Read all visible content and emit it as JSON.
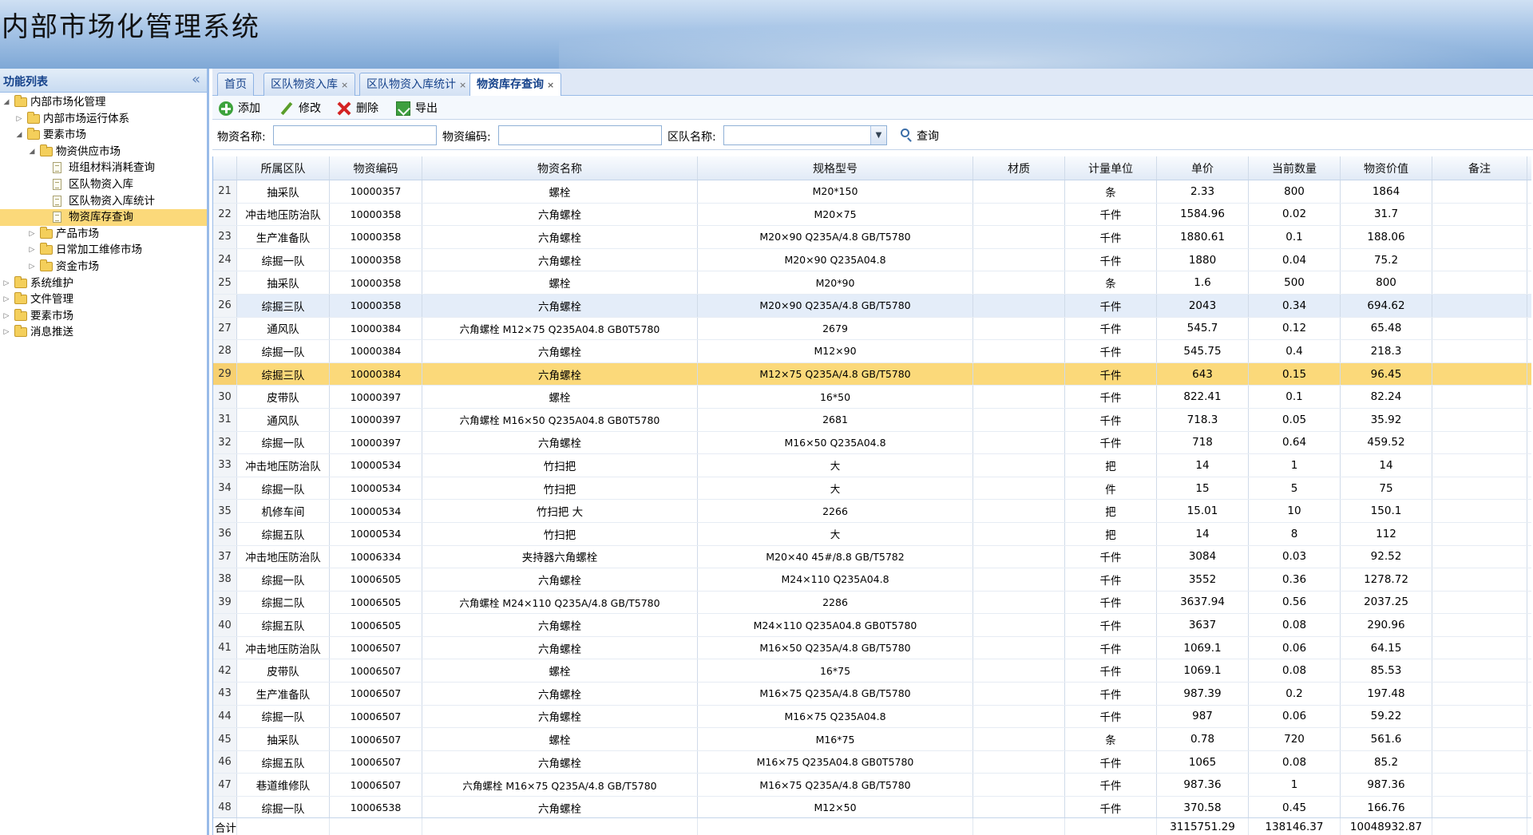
{
  "app": {
    "title": "内部市场化管理系统"
  },
  "sidebar": {
    "header": "功能列表",
    "collapse_glyph": "«",
    "items": [
      {
        "label": "内部市场化管理",
        "level": 0,
        "type": "folder",
        "state": "open"
      },
      {
        "label": "内部市场运行体系",
        "level": 1,
        "type": "folder",
        "state": "closed"
      },
      {
        "label": "要素市场",
        "level": 1,
        "type": "folder",
        "state": "open"
      },
      {
        "label": "物资供应市场",
        "level": 2,
        "type": "folder",
        "state": "open"
      },
      {
        "label": "班组材料消耗查询",
        "level": 3,
        "type": "doc"
      },
      {
        "label": "区队物资入库",
        "level": 3,
        "type": "doc"
      },
      {
        "label": "区队物资入库统计",
        "level": 3,
        "type": "doc"
      },
      {
        "label": "物资库存查询",
        "level": 3,
        "type": "doc",
        "selected": true
      },
      {
        "label": "产品市场",
        "level": 2,
        "type": "folder",
        "state": "closed"
      },
      {
        "label": "日常加工维修市场",
        "level": 2,
        "type": "folder",
        "state": "closed"
      },
      {
        "label": "资金市场",
        "level": 2,
        "type": "folder",
        "state": "closed"
      },
      {
        "label": "系统维护",
        "level": 0,
        "type": "folder",
        "state": "closed"
      },
      {
        "label": "文件管理",
        "level": 0,
        "type": "folder",
        "state": "closed"
      },
      {
        "label": "要素市场",
        "level": 0,
        "type": "folder",
        "state": "closed"
      },
      {
        "label": "消息推送",
        "level": 0,
        "type": "folder",
        "state": "closed"
      }
    ]
  },
  "tabs": [
    {
      "label": "首页",
      "closable": false,
      "active": false
    },
    {
      "label": "区队物资入库",
      "closable": true,
      "active": false
    },
    {
      "label": "区队物资入库统计",
      "closable": true,
      "active": false
    },
    {
      "label": "物资库存查询",
      "closable": true,
      "active": true
    }
  ],
  "toolbar": {
    "add": "添加",
    "edit": "修改",
    "delete": "删除",
    "export": "导出"
  },
  "search": {
    "name_label": "物资名称:",
    "name_value": "",
    "code_label": "物资编码:",
    "code_value": "",
    "team_label": "区队名称:",
    "team_value": "",
    "query_label": "查询"
  },
  "grid": {
    "columns": [
      "",
      "所属区队",
      "物资编码",
      "物资名称",
      "规格型号",
      "材质",
      "计量单位",
      "单价",
      "当前数量",
      "物资价值",
      "备注"
    ],
    "rows": [
      [
        "21",
        "抽采队",
        "10000357",
        "螺栓",
        "M20*150",
        "",
        "条",
        "2.33",
        "800",
        "1864",
        ""
      ],
      [
        "22",
        "冲击地压防治队",
        "10000358",
        "六角螺栓",
        "M20×75",
        "",
        "千件",
        "1584.96",
        "0.02",
        "31.7",
        ""
      ],
      [
        "23",
        "生产准备队",
        "10000358",
        "六角螺栓",
        "M20×90 Q235A/4.8 GB/T5780",
        "",
        "千件",
        "1880.61",
        "0.1",
        "188.06",
        ""
      ],
      [
        "24",
        "综掘一队",
        "10000358",
        "六角螺栓",
        "M20×90 Q235A04.8",
        "",
        "千件",
        "1880",
        "0.04",
        "75.2",
        ""
      ],
      [
        "25",
        "抽采队",
        "10000358",
        "螺栓",
        "M20*90",
        "",
        "条",
        "1.6",
        "500",
        "800",
        ""
      ],
      [
        "26",
        "综掘三队",
        "10000358",
        "六角螺栓",
        "M20×90 Q235A/4.8 GB/T5780",
        "",
        "千件",
        "2043",
        "0.34",
        "694.62",
        ""
      ],
      [
        "27",
        "通风队",
        "10000384",
        "六角螺栓 M12×75 Q235A04.8 GB0T5780",
        "2679",
        "",
        "千件",
        "545.7",
        "0.12",
        "65.48",
        ""
      ],
      [
        "28",
        "综掘一队",
        "10000384",
        "六角螺栓",
        "M12×90",
        "",
        "千件",
        "545.75",
        "0.4",
        "218.3",
        ""
      ],
      [
        "29",
        "综掘三队",
        "10000384",
        "六角螺栓",
        "M12×75 Q235A/4.8 GB/T5780",
        "",
        "千件",
        "643",
        "0.15",
        "96.45",
        ""
      ],
      [
        "30",
        "皮带队",
        "10000397",
        "螺栓",
        "16*50",
        "",
        "千件",
        "822.41",
        "0.1",
        "82.24",
        ""
      ],
      [
        "31",
        "通风队",
        "10000397",
        "六角螺栓 M16×50 Q235A04.8 GB0T5780",
        "2681",
        "",
        "千件",
        "718.3",
        "0.05",
        "35.92",
        ""
      ],
      [
        "32",
        "综掘一队",
        "10000397",
        "六角螺栓",
        "M16×50 Q235A04.8",
        "",
        "千件",
        "718",
        "0.64",
        "459.52",
        ""
      ],
      [
        "33",
        "冲击地压防治队",
        "10000534",
        "竹扫把",
        "大",
        "",
        "把",
        "14",
        "1",
        "14",
        ""
      ],
      [
        "34",
        "综掘一队",
        "10000534",
        "竹扫把",
        "大",
        "",
        "件",
        "15",
        "5",
        "75",
        ""
      ],
      [
        "35",
        "机修车间",
        "10000534",
        "竹扫把 大",
        "2266",
        "",
        "把",
        "15.01",
        "10",
        "150.1",
        ""
      ],
      [
        "36",
        "综掘五队",
        "10000534",
        "竹扫把",
        "大",
        "",
        "把",
        "14",
        "8",
        "112",
        ""
      ],
      [
        "37",
        "冲击地压防治队",
        "10006334",
        "夹持器六角螺栓",
        "M20×40 45#/8.8 GB/T5782",
        "",
        "千件",
        "3084",
        "0.03",
        "92.52",
        ""
      ],
      [
        "38",
        "综掘一队",
        "10006505",
        "六角螺栓",
        "M24×110 Q235A04.8",
        "",
        "千件",
        "3552",
        "0.36",
        "1278.72",
        ""
      ],
      [
        "39",
        "综掘二队",
        "10006505",
        "六角螺栓 M24×110 Q235A/4.8 GB/T5780",
        "2286",
        "",
        "千件",
        "3637.94",
        "0.56",
        "2037.25",
        ""
      ],
      [
        "40",
        "综掘五队",
        "10006505",
        "六角螺栓",
        "M24×110 Q235A04.8 GB0T5780",
        "",
        "千件",
        "3637",
        "0.08",
        "290.96",
        ""
      ],
      [
        "41",
        "冲击地压防治队",
        "10006507",
        "六角螺栓",
        "M16×50 Q235A/4.8 GB/T5780",
        "",
        "千件",
        "1069.1",
        "0.06",
        "64.15",
        ""
      ],
      [
        "42",
        "皮带队",
        "10006507",
        "螺栓",
        "16*75",
        "",
        "千件",
        "1069.1",
        "0.08",
        "85.53",
        ""
      ],
      [
        "43",
        "生产准备队",
        "10006507",
        "六角螺栓",
        "M16×75 Q235A/4.8 GB/T5780",
        "",
        "千件",
        "987.39",
        "0.2",
        "197.48",
        ""
      ],
      [
        "44",
        "综掘一队",
        "10006507",
        "六角螺栓",
        "M16×75 Q235A04.8",
        "",
        "千件",
        "987",
        "0.06",
        "59.22",
        ""
      ],
      [
        "45",
        "抽采队",
        "10006507",
        "螺栓",
        "M16*75",
        "",
        "条",
        "0.78",
        "720",
        "561.6",
        ""
      ],
      [
        "46",
        "综掘五队",
        "10006507",
        "六角螺栓",
        "M16×75 Q235A04.8 GB0T5780",
        "",
        "千件",
        "1065",
        "0.08",
        "85.2",
        ""
      ],
      [
        "47",
        "巷道维修队",
        "10006507",
        "六角螺栓 M16×75 Q235A/4.8 GB/T5780",
        "M16×75 Q235A/4.8 GB/T5780",
        "",
        "千件",
        "987.36",
        "1",
        "987.36",
        ""
      ],
      [
        "48",
        "综掘一队",
        "10006538",
        "六角螺栓",
        "M12×50",
        "",
        "千件",
        "370.58",
        "0.45",
        "166.76",
        ""
      ]
    ],
    "hover_row": 5,
    "selected_row": 8,
    "footer": {
      "label": "合计:",
      "unit_price_total": "3115751.29",
      "qty_total": "138146.37",
      "value_total": "10048932.87"
    }
  },
  "colors": {
    "selected": "#fbd97a",
    "hover": "#e4edf9",
    "border": "#99bbe8",
    "header_text": "#15428b"
  }
}
